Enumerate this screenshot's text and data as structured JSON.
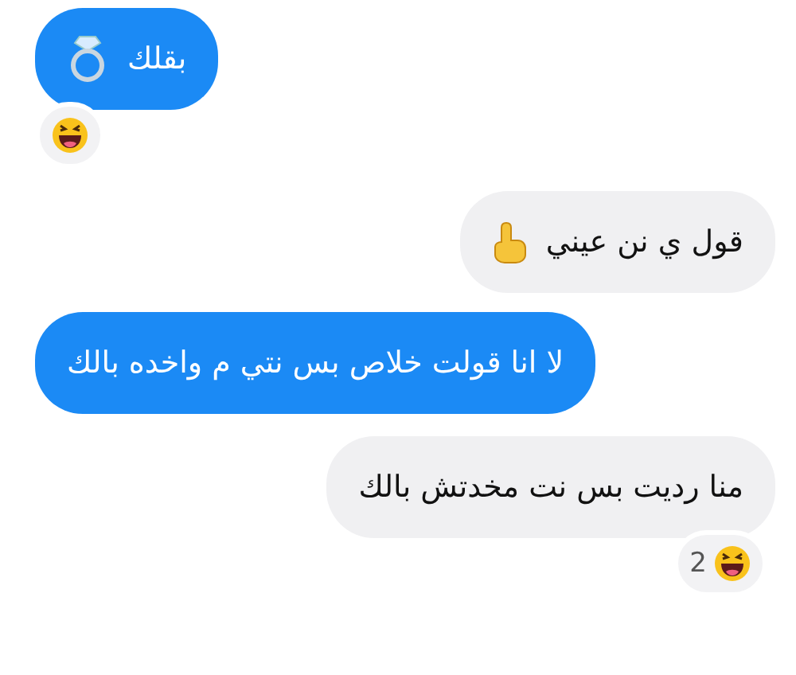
{
  "messages": [
    {
      "kind": "blue",
      "text": "بقلك",
      "emoji": {
        "kind": "ring"
      },
      "reaction": {
        "emoji": {
          "kind": "laugh"
        }
      }
    },
    {
      "kind": "gray",
      "text": "قول ي نن عيني",
      "emoji": {
        "kind": "finger"
      }
    },
    {
      "kind": "blue",
      "text": "لا انا قولت خلاص بس نتي م واخده بالك"
    },
    {
      "kind": "gray",
      "text": "منا رديت بس نت مخدتش بالك",
      "reaction": {
        "emoji": {
          "kind": "laugh"
        },
        "count": "2"
      }
    }
  ]
}
